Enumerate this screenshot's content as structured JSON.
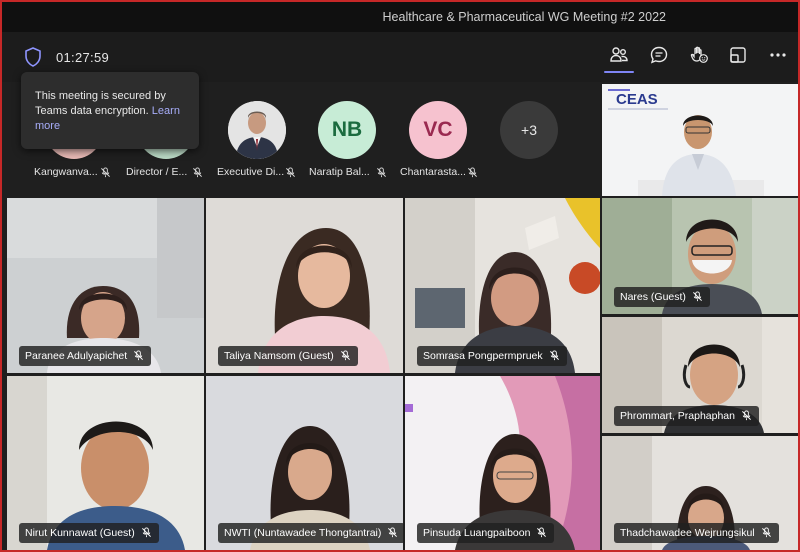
{
  "window": {
    "title": "Healthcare & Pharmaceutical WG Meeting #2 2022"
  },
  "toolbar": {
    "timer": "01:27:59",
    "icons": [
      "shield-icon",
      "people-icon",
      "chat-icon",
      "raise-hand-icon",
      "view-icon",
      "more-icon"
    ],
    "accent_color": "#7f85f5"
  },
  "tooltip": {
    "text": "This meeting is secured by Teams data encryption.",
    "link": "Learn more"
  },
  "strip": {
    "participants": [
      {
        "initials": "",
        "label": "Kangwanva..."
      },
      {
        "initials": "",
        "label": "Director / E..."
      },
      {
        "initials": "",
        "label": "Executive Di..."
      },
      {
        "initials": "NB",
        "label": "Naratip Bal..."
      },
      {
        "initials": "VC",
        "label": "Chantarasta..."
      }
    ],
    "overflow": "+3"
  },
  "tiles": {
    "t1": "Paranee Adulyapichet",
    "t2": "Taliya Namsom (Guest)",
    "t3": "Somrasa Pongpermpruek",
    "t4": "Nirut Kunnawat (Guest)",
    "t5": "NWTI (Nuntawadee Thongtantrai)",
    "t6": "Pinsuda Luangpaiboon",
    "r2": "Nares (Guest)",
    "r3": "Phrommart, Praphaphan",
    "r4": "Thadchawadee Wejrungsikul"
  }
}
